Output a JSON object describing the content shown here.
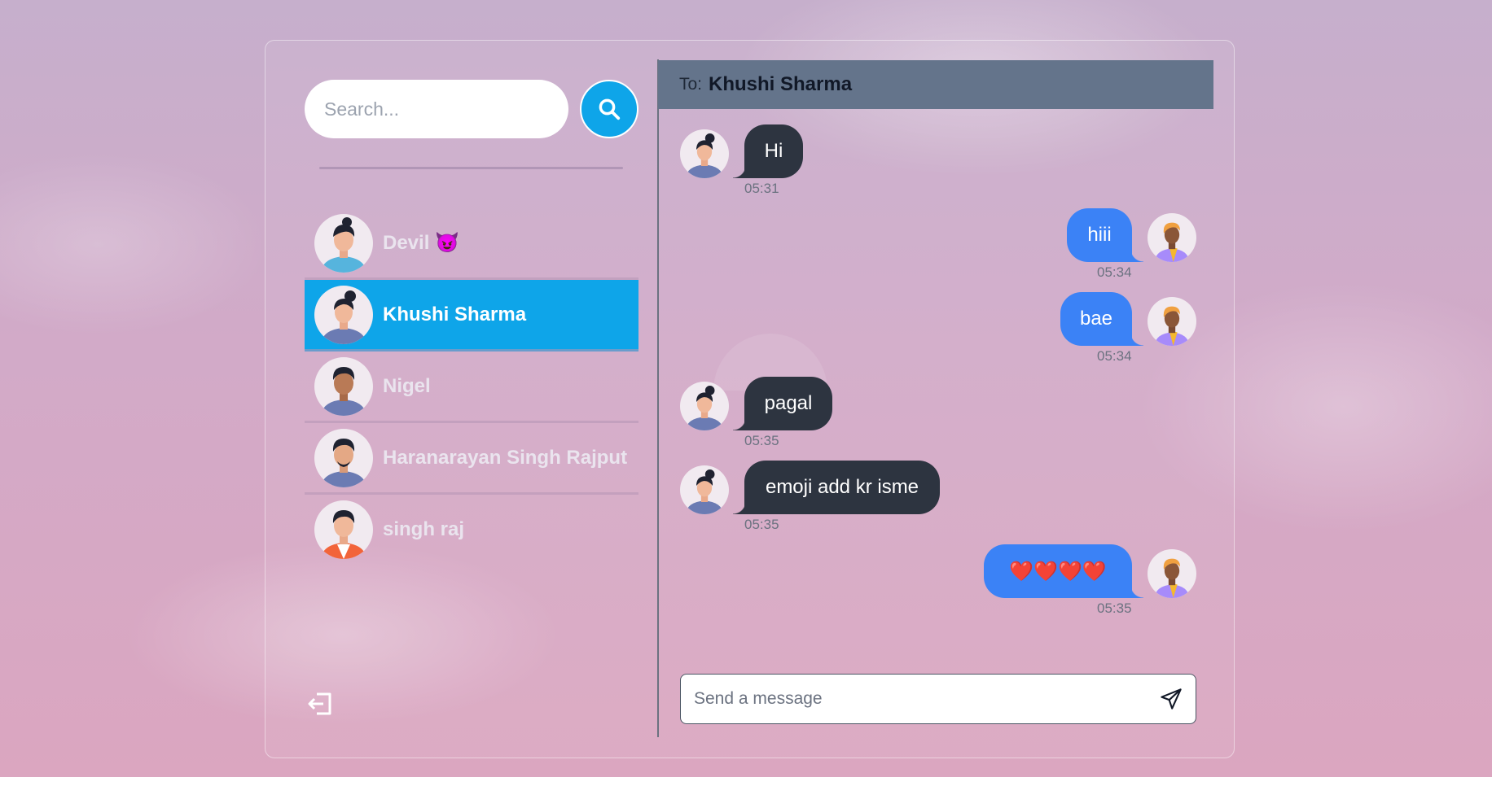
{
  "search": {
    "placeholder": "Search..."
  },
  "users": [
    {
      "name": "Devil 😈",
      "avatar": "avatar-man-blue",
      "selected": false
    },
    {
      "name": "Khushi Sharma",
      "avatar": "avatar-woman-bun",
      "selected": true
    },
    {
      "name": "Nigel",
      "avatar": "avatar-man-dark",
      "selected": false
    },
    {
      "name": "Haranarayan Singh Rajput",
      "avatar": "avatar-man-purple",
      "selected": false
    },
    {
      "name": "singh raj",
      "avatar": "avatar-man-orange",
      "selected": false
    }
  ],
  "chat": {
    "to_label": "To:",
    "to_name": "Khushi Sharma",
    "messages": [
      {
        "direction": "incoming",
        "text": "Hi",
        "time": "05:31"
      },
      {
        "direction": "outgoing",
        "text": "hiii",
        "time": "05:34"
      },
      {
        "direction": "outgoing",
        "text": "bae",
        "time": "05:34"
      },
      {
        "direction": "incoming",
        "text": "pagal",
        "time": "05:35"
      },
      {
        "direction": "incoming",
        "text": "emoji add kr isme",
        "time": "05:35"
      },
      {
        "direction": "outgoing",
        "text": "❤️❤️❤️❤️",
        "time": "05:35"
      }
    ],
    "input_placeholder": "Send a message"
  },
  "icons": {
    "search": "search-icon",
    "logout": "logout-icon",
    "send": "send-icon"
  },
  "colors": {
    "accent": "#0ea5e9",
    "outgoing_bubble": "#3b82f6",
    "incoming_bubble": "#2d3440",
    "header": "#64748b"
  }
}
